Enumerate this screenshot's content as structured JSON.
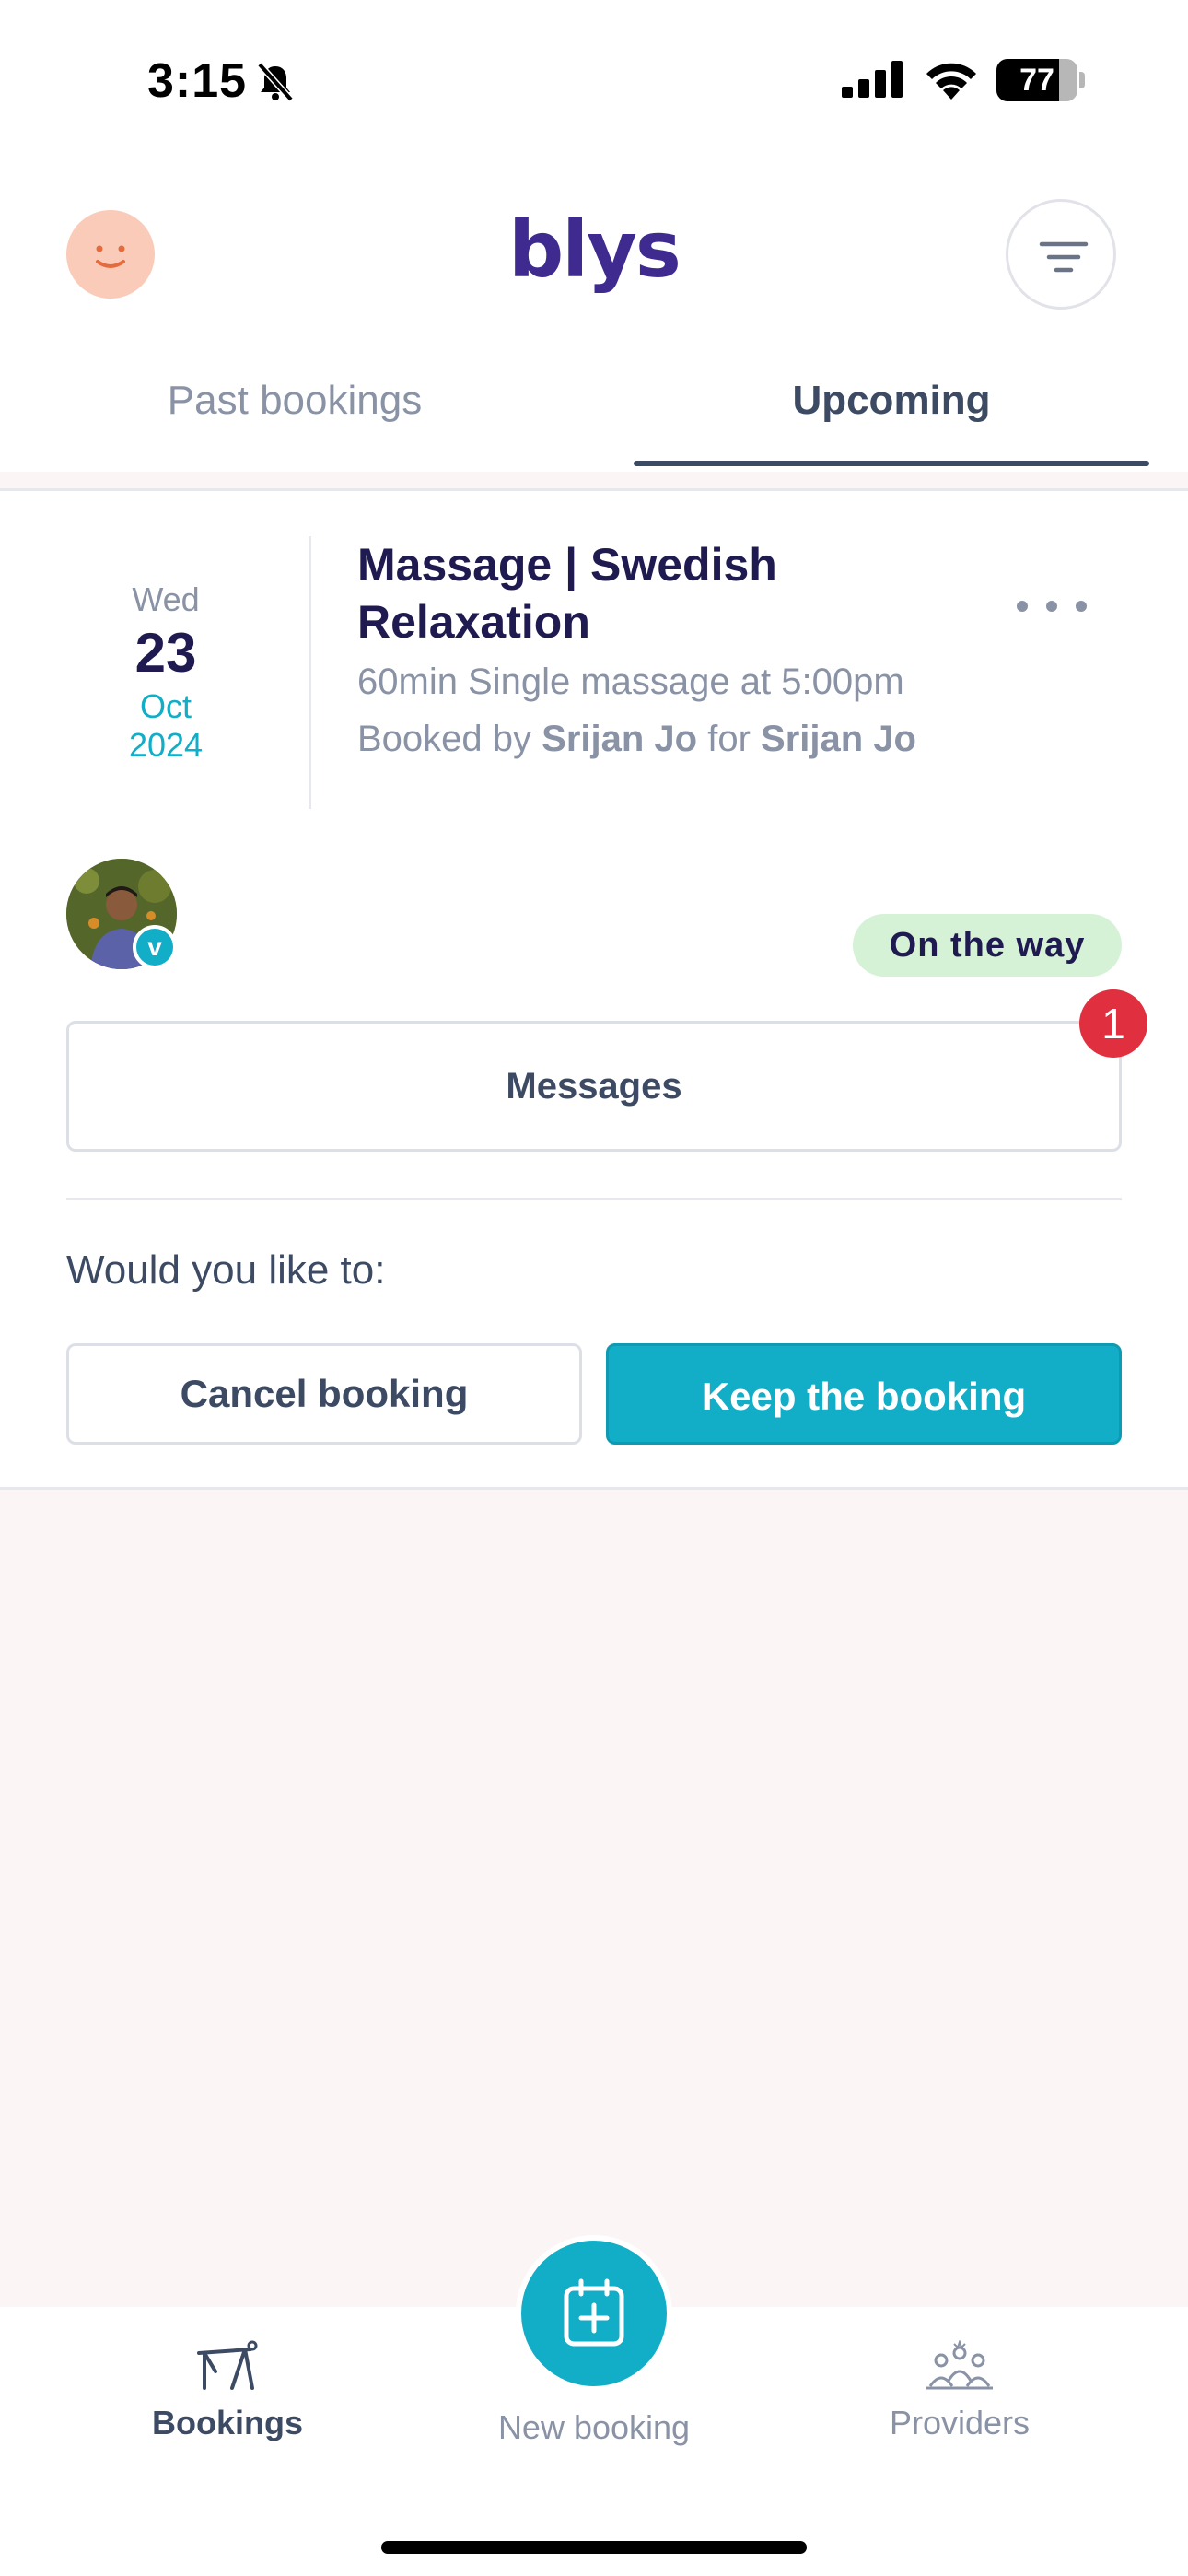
{
  "status_bar": {
    "time": "3:15",
    "battery_level": "77",
    "battery_fraction": 0.77,
    "icons": [
      "bell-slash-icon",
      "cellular-signal-icon",
      "wifi-icon",
      "battery-icon"
    ]
  },
  "header": {
    "brand": "blys",
    "profile_icon": "smiley-avatar-icon",
    "filter_icon": "filter-icon"
  },
  "tabs": [
    {
      "label": "Past bookings",
      "active": false
    },
    {
      "label": "Upcoming",
      "active": true
    }
  ],
  "booking": {
    "date": {
      "weekday": "Wed",
      "day": "23",
      "month": "Oct",
      "year": "2024"
    },
    "title": "Massage | Swedish Relaxation",
    "duration_text": "60min Single massage at 5:00pm",
    "booked_by_prefix": "Booked by",
    "booked_by": "Srijan Jo",
    "for_word": "for",
    "booked_for": "Srijan Jo",
    "status": "On the way",
    "messages_label": "Messages",
    "unread_messages": "1",
    "prompt": "Would you like to:",
    "cancel_label": "Cancel booking",
    "keep_label": "Keep the booking"
  },
  "bottom_nav": {
    "items": [
      {
        "label": "Bookings",
        "icon": "massage-table-icon",
        "active": true
      },
      {
        "label": "New booking",
        "icon": "calendar-plus-icon",
        "active": false
      },
      {
        "label": "Providers",
        "icon": "people-group-icon",
        "active": false
      }
    ]
  },
  "colors": {
    "brand": "#3f2b8f",
    "accent": "#12adc7",
    "status_badge_bg": "#d6f2d6",
    "notification": "#e0303f",
    "page_bg": "#fcf5f5"
  }
}
